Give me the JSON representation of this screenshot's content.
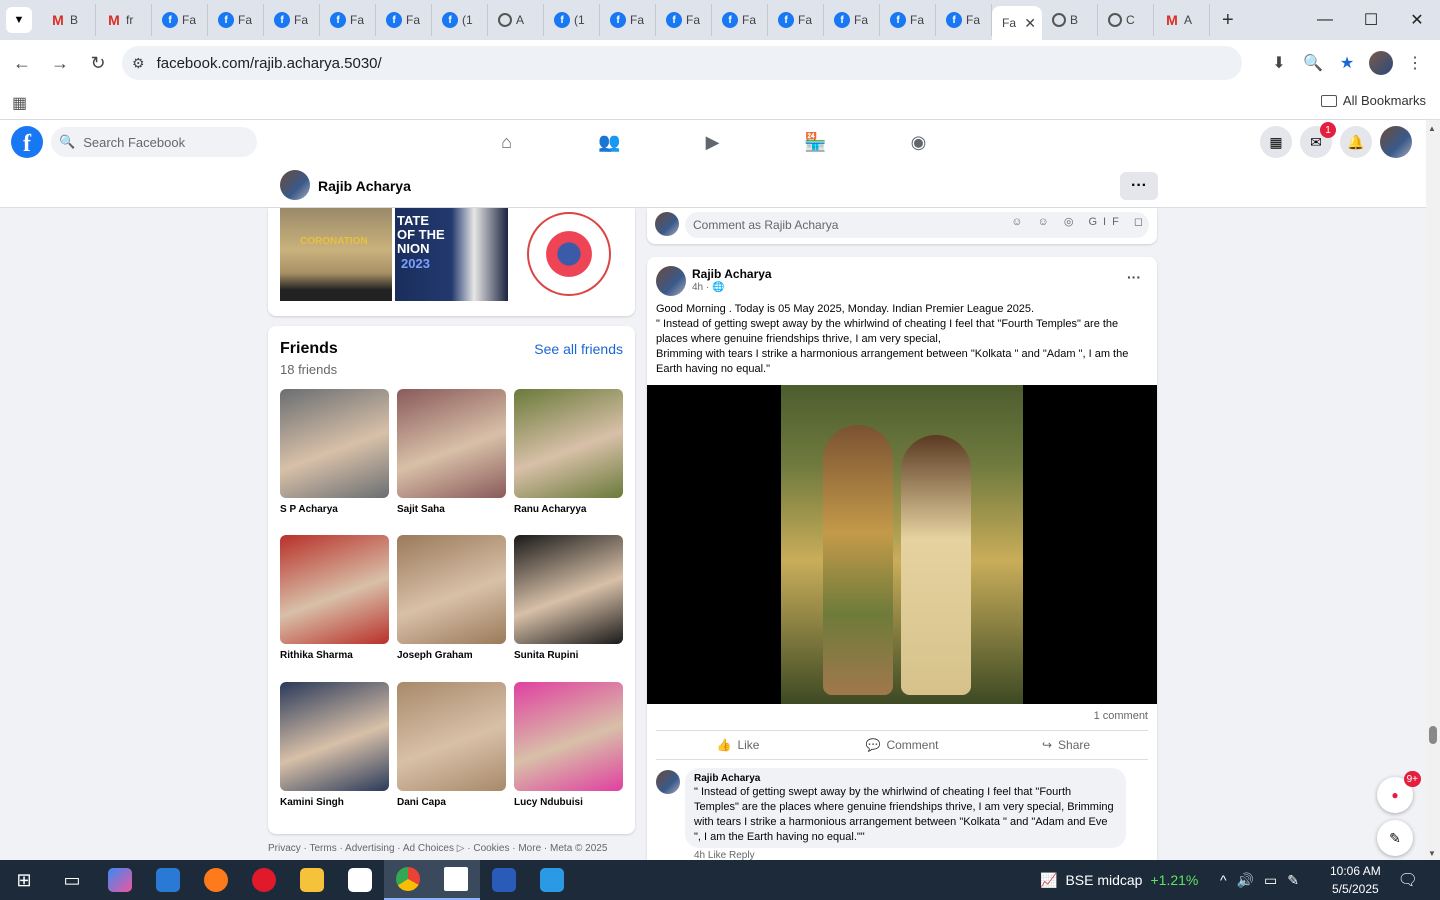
{
  "browser": {
    "tabs": [
      {
        "icon": "gmail",
        "label": "B"
      },
      {
        "icon": "gmail",
        "label": "fr"
      },
      {
        "icon": "facebook",
        "label": "Fa"
      },
      {
        "icon": "facebook",
        "label": "Fa"
      },
      {
        "icon": "facebook",
        "label": "Fa"
      },
      {
        "icon": "facebook",
        "label": "Fa"
      },
      {
        "icon": "facebook",
        "label": "Fa"
      },
      {
        "icon": "facebook",
        "label": "(1"
      },
      {
        "icon": "web",
        "label": "A"
      },
      {
        "icon": "facebook",
        "label": "(1"
      },
      {
        "icon": "facebook",
        "label": "Fa"
      },
      {
        "icon": "facebook",
        "label": "Fa"
      },
      {
        "icon": "facebook",
        "label": "Fa"
      },
      {
        "icon": "facebook",
        "label": "Fa"
      },
      {
        "icon": "facebook",
        "label": "Fa"
      },
      {
        "icon": "facebook",
        "label": "Fa"
      },
      {
        "icon": "facebook",
        "label": "Fa"
      },
      {
        "icon": "facebook",
        "label": "Fa",
        "active": true
      },
      {
        "icon": "web",
        "label": "B"
      },
      {
        "icon": "web",
        "label": "C"
      },
      {
        "icon": "gmail",
        "label": "A"
      }
    ],
    "url": "facebook.com/rajib.acharya.5030/",
    "all_bookmarks": "All Bookmarks"
  },
  "fb": {
    "search_placeholder": "Search Facebook",
    "messenger_badge": "1",
    "profile_name": "Rajib Acharya",
    "more_button": "···",
    "friends": {
      "title": "Friends",
      "count": "18 friends",
      "see_all": "See all friends",
      "list": [
        {
          "name": "S P Acharya",
          "color": "#6a6e72"
        },
        {
          "name": "Sajit Saha",
          "color": "#8a5a5a"
        },
        {
          "name": "Ranu Acharyya",
          "color": "#6a7a3a"
        },
        {
          "name": "Rithika Sharma",
          "color": "#b8302a"
        },
        {
          "name": "Joseph Graham",
          "color": "#9a7a5a"
        },
        {
          "name": "Sunita Rupini",
          "color": "#1a1a1a"
        },
        {
          "name": "Kamini Singh",
          "color": "#2a3a5a"
        },
        {
          "name": "Dani Capa",
          "color": "#a88a6a"
        },
        {
          "name": "Lucy Ndubuisi",
          "color": "#e040a0"
        }
      ]
    },
    "photo_captions": {
      "p1": "CORONATION",
      "p2_line1": "TATE",
      "p2_line2": "OF THE",
      "p2_line3": "NION",
      "p2_year": "2023"
    },
    "footer": "Privacy · Terms · Advertising · Ad Choices ▷ · Cookies · More · Meta © 2025",
    "comment_placeholder": "Comment as Rajib Acharya",
    "comment_icons": "☺ ☺ ◎ GIF ◻",
    "post": {
      "author": "Rajib Acharya",
      "time": "4h · 🌐",
      "line1": "Good Morning . Today is 05 May 2025, Monday. Indian Premier League 2025.",
      "line2": "\" Instead of getting swept away by the whirlwind of cheating I feel that \"Fourth Temples\" are the places where genuine friendships thrive, I am very special,",
      "line3": "Brimming with tears I strike a harmonious arrangement between \"Kolkata \" and \"Adam \", I am the Earth having no equal.\"",
      "comments_count": "1 comment",
      "like": "Like",
      "comment": "Comment",
      "share": "Share"
    },
    "comment": {
      "author": "Rajib Acharya",
      "text": "\" Instead of getting swept away by the whirlwind of cheating I feel that \"Fourth Temples\" are the places where genuine friendships thrive, I am very special, Brimming with tears I strike a harmonious arrangement between \"Kolkata \" and \"Adam and Eve \", I am the Earth having no equal.\"\"",
      "footer": "4h   Like   Reply"
    },
    "news_badge": "9+"
  },
  "taskbar": {
    "stock_name": "BSE midcap",
    "stock_change": "+1.21%",
    "time": "10:06 AM",
    "date": "5/5/2025"
  }
}
